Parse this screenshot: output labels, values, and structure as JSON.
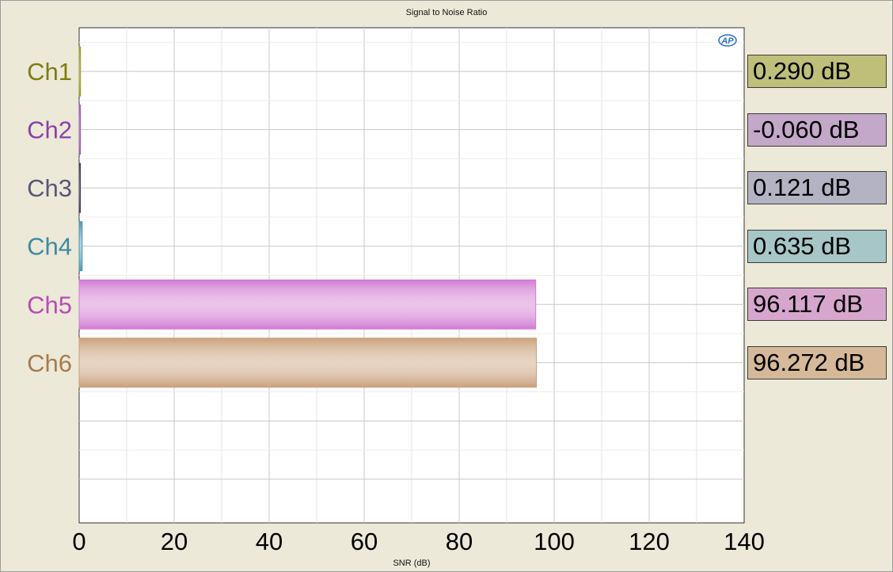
{
  "chart_data": {
    "type": "bar",
    "orientation": "horizontal",
    "title": "Signal to Noise Ratio",
    "xlabel": "SNR (dB)",
    "xlim": [
      0,
      140
    ],
    "xticks": [
      0,
      20,
      40,
      60,
      80,
      100,
      120,
      140
    ],
    "grid": true,
    "categories": [
      "Ch1",
      "Ch2",
      "Ch3",
      "Ch4",
      "Ch5",
      "Ch6"
    ],
    "values": [
      0.29,
      -0.06,
      0.121,
      0.635,
      96.117,
      96.272
    ],
    "value_labels": [
      "0.290 dB",
      "-0.060 dB",
      "0.121 dB",
      "0.635 dB",
      "96.117 dB",
      "96.272 dB"
    ],
    "label_colors": [
      "#7d7d10",
      "#8a3fae",
      "#56567a",
      "#3d8aa3",
      "#b94ab8",
      "#a87a4e"
    ],
    "bar_colors": [
      "#9a9a28",
      "#9b59b6",
      "#3b3b5e",
      "#4e95b0",
      "#d27ad2",
      "#c9a07a"
    ],
    "readout_colors": [
      "#bfbf7a",
      "#c3a8c9",
      "#b3b3c4",
      "#a7c6c8",
      "#d7a6cf",
      "#d5b999"
    ]
  },
  "logo_text": "AP"
}
